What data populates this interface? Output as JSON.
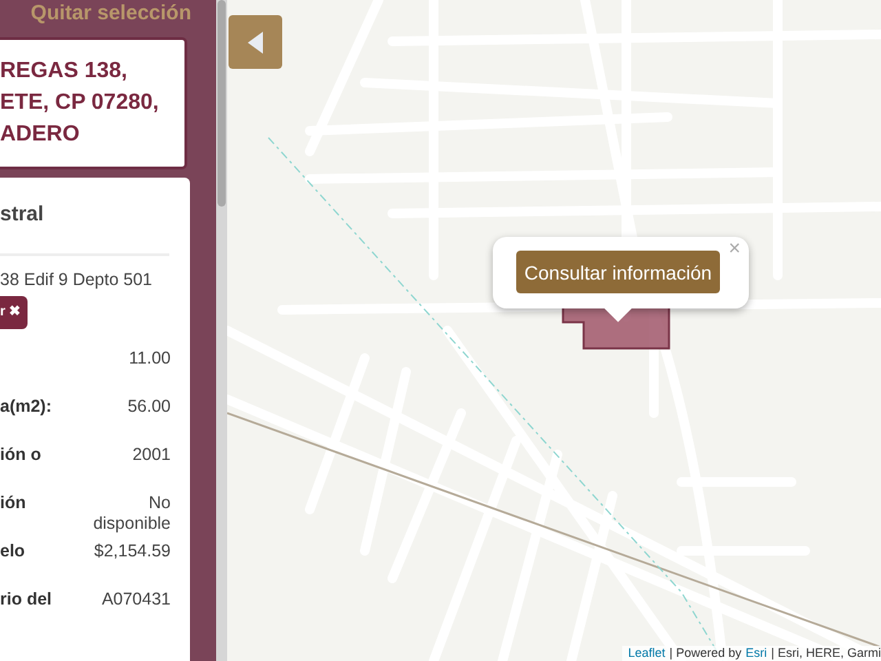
{
  "sidebar": {
    "clear_selection": "Quitar selección",
    "address_lines": [
      "REGAS 138,",
      "ETE, CP 07280,",
      "ADERO"
    ],
    "card": {
      "title": "stral",
      "subtitle": "38 Edif 9 Depto 501",
      "remove_button": {
        "label": "r",
        "icon": "✖"
      },
      "fields": [
        {
          "value": "11.00"
        },
        {
          "label": "a(m2):",
          "value": "56.00"
        },
        {
          "label": "ión o",
          "value": "2001"
        },
        {
          "label": "ión",
          "value": "No disponible"
        },
        {
          "label": "elo",
          "value": "$2,154.59"
        },
        {
          "label": "rio del",
          "value": "A070431"
        }
      ]
    }
  },
  "map": {
    "popup": {
      "button": "Consultar información",
      "close": "×"
    },
    "attribution": [
      {
        "text": "Leaflet",
        "link": true
      },
      {
        "text": "| Powered by",
        "link": false
      },
      {
        "text": "Esri",
        "link": true
      },
      {
        "text": "| Esri, HERE, Garmi",
        "link": false
      }
    ]
  }
}
